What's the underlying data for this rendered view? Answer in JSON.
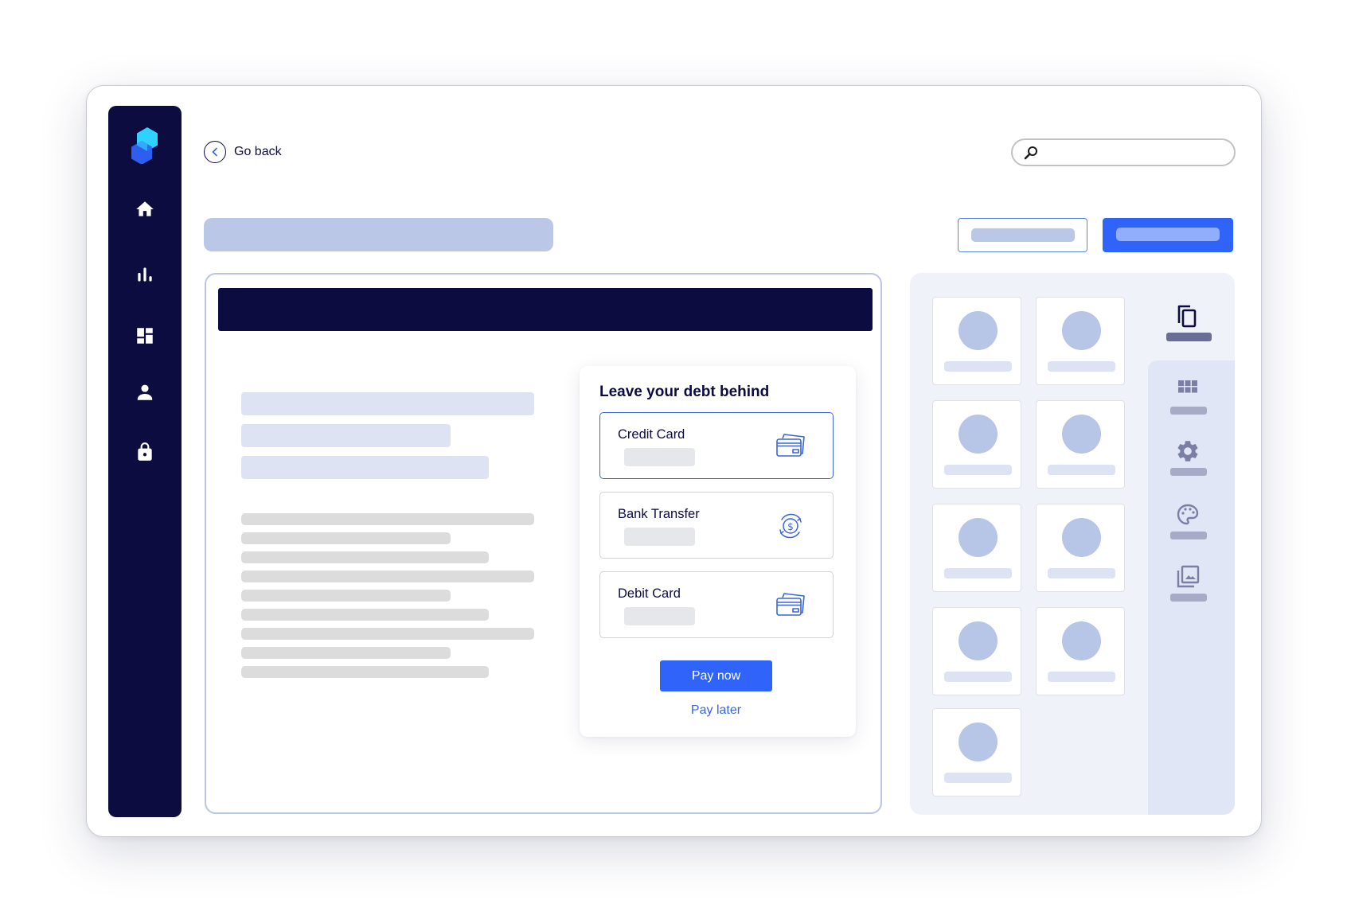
{
  "app": {
    "logo": "hexagon-logo",
    "colors": {
      "navy": "#0d0c40",
      "primary": "#2f63fa",
      "link": "#3a66d8",
      "skeleton_blue": "#bac7e6",
      "skeleton_gray": "#dcdcdc"
    }
  },
  "sidebar": {
    "items": [
      {
        "name": "home",
        "icon": "home-icon"
      },
      {
        "name": "analytics",
        "icon": "bar-chart-icon"
      },
      {
        "name": "dashboard",
        "icon": "dashboard-icon"
      },
      {
        "name": "profile",
        "icon": "user-icon"
      },
      {
        "name": "security",
        "icon": "lock-icon"
      }
    ]
  },
  "header": {
    "back_label": "Go back",
    "back_icon": "chevron-left-icon",
    "search": {
      "icon": "search-icon",
      "value": "",
      "placeholder": ""
    }
  },
  "payment": {
    "title": "Leave your debt behind",
    "options": [
      {
        "label": "Credit Card",
        "icon": "credit-card-icon",
        "selected": true
      },
      {
        "label": "Bank Transfer",
        "icon": "money-transfer-icon",
        "selected": false
      },
      {
        "label": "Debit Card",
        "icon": "debit-card-icon",
        "selected": false
      }
    ],
    "pay_now_label": "Pay now",
    "pay_later_label": "Pay later"
  },
  "right_panel": {
    "tile_count": 9,
    "tabs": [
      {
        "name": "pages",
        "icon": "copy-icon",
        "active": true
      },
      {
        "name": "layouts",
        "icon": "grid-icon",
        "active": false
      },
      {
        "name": "settings",
        "icon": "gear-icon",
        "active": false
      },
      {
        "name": "theme",
        "icon": "palette-icon",
        "active": false
      },
      {
        "name": "media",
        "icon": "image-gallery-icon",
        "active": false
      }
    ]
  }
}
